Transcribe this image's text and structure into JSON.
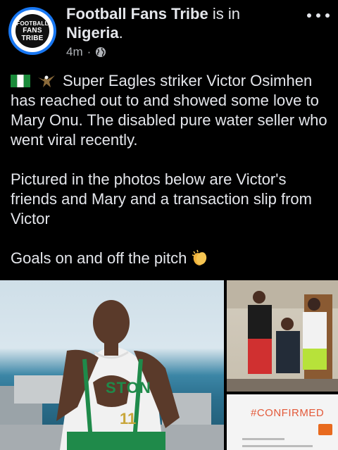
{
  "post": {
    "page_name": "Football Fans Tribe",
    "location_prefix": "is in",
    "location": "Nigeria",
    "location_suffix": ".",
    "time": "4m",
    "time_separator": "·",
    "avatar_text": [
      "FOOTBALL",
      "FANS",
      "TRIBE"
    ],
    "paragraph1": "Super Eagles striker Victor Osimhen has reached out to and showed some love to Mary Onu. The disabled pure water seller who went viral recently.",
    "paragraph2": "Pictured in the photos below are Victor's friends and Mary and a transaction slip from Victor",
    "paragraph3": "Goals on and off the pitch",
    "icons": {
      "flag": "nigeria-flag-icon",
      "eagle": "eagle-icon",
      "clap": "clapping-hands-icon",
      "audience": "globe-icon",
      "menu": "more-options-icon"
    }
  },
  "photos": {
    "slip_text": "#CONFIRMED",
    "jersey_text": "STON",
    "jersey_number": "11"
  },
  "colors": {
    "background": "#000000",
    "text": "#e4e6eb",
    "secondary_text": "#b0b3b8",
    "avatar_ring": "#1877f2",
    "confirmed": "#e35a3a"
  }
}
